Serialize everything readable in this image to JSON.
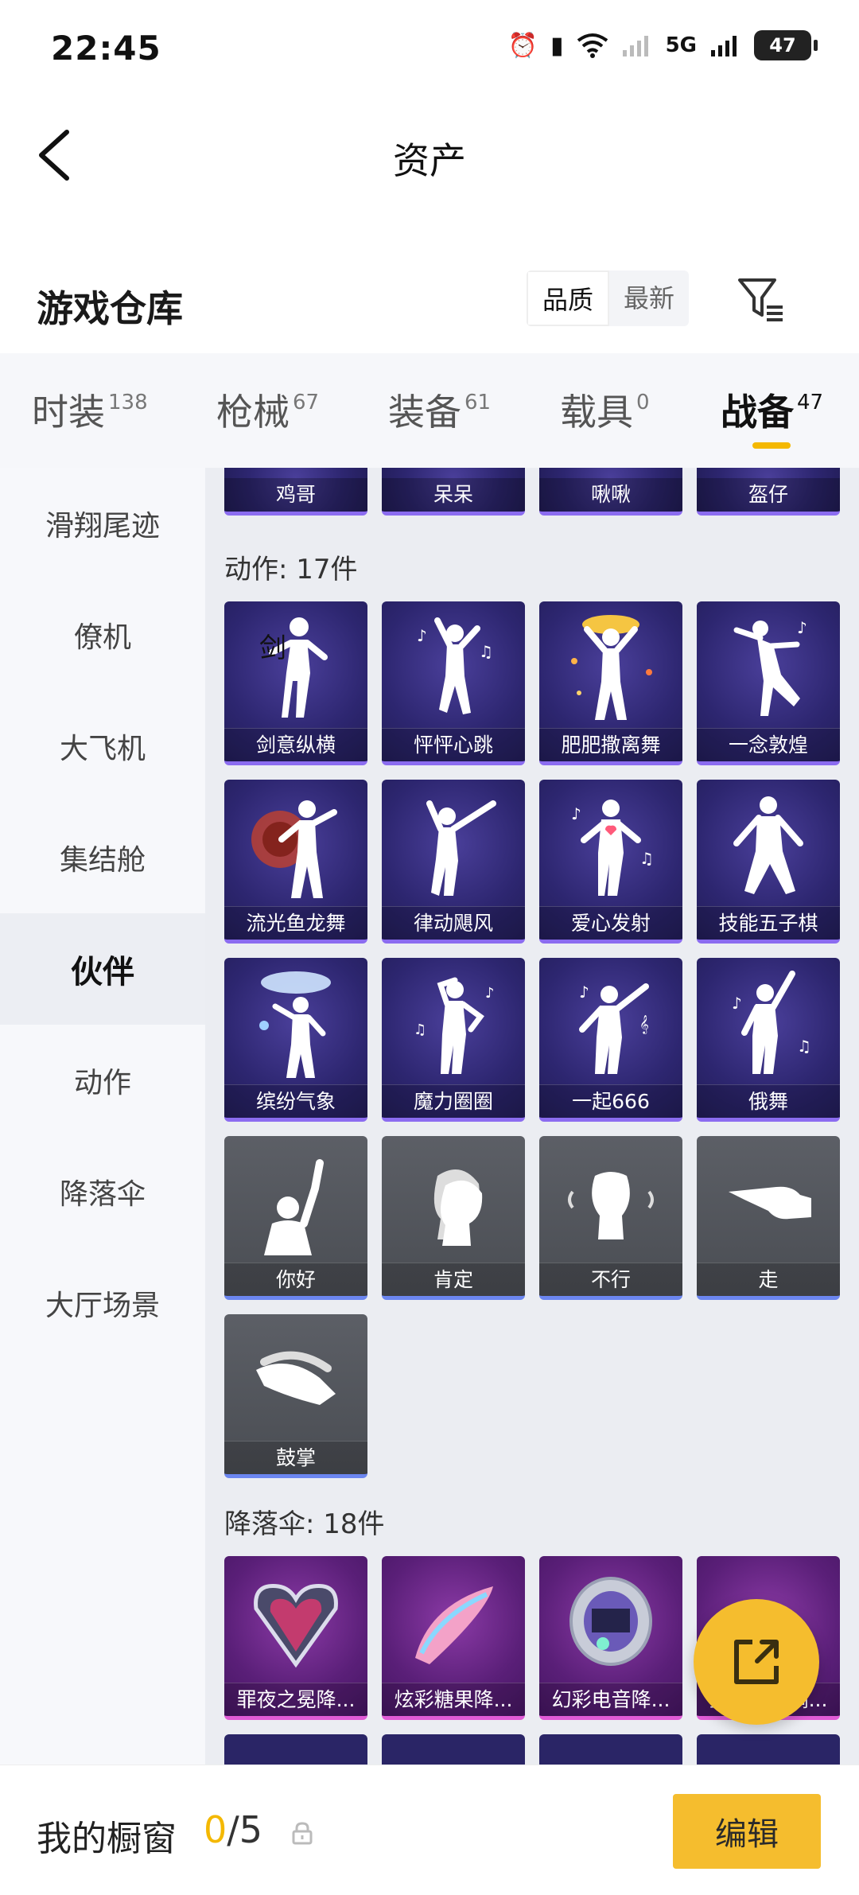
{
  "status_bar": {
    "time": "22:45",
    "battery": "47",
    "network": "5G"
  },
  "header": {
    "title": "资产"
  },
  "section": {
    "title": "游戏仓库"
  },
  "sort": {
    "options": [
      "品质",
      "最新"
    ],
    "active": "品质"
  },
  "tabs": [
    {
      "label": "时装",
      "count": "138"
    },
    {
      "label": "枪械",
      "count": "67"
    },
    {
      "label": "装备",
      "count": "61"
    },
    {
      "label": "载具",
      "count": "0"
    },
    {
      "label": "战备",
      "count": "47",
      "active": true
    }
  ],
  "sidebar": {
    "items": [
      "滑翔尾迹",
      "僚机",
      "大飞机",
      "集结舱",
      "伙伴",
      "动作",
      "降落伞",
      "大厅场景"
    ],
    "active": "伙伴"
  },
  "partners_row": [
    "鸡哥",
    "呆呆",
    "啾啾",
    "盔仔"
  ],
  "actions": {
    "title": "动作: 17件",
    "items": [
      "剑意纵横",
      "怦怦心跳",
      "肥肥撒离舞",
      "一念敦煌",
      "流光鱼龙舞",
      "律动飓风",
      "爱心发射",
      "技能五子棋",
      "缤纷气象",
      "魔力圈圈",
      "一起666",
      "俄舞",
      "你好",
      "肯定",
      "不行",
      "走",
      "鼓掌"
    ]
  },
  "parachutes": {
    "title": "降落伞: 18件",
    "items": [
      "罪夜之冕降...",
      "炫彩糖果降...",
      "幻彩电音降...",
      "星穹泳驭调..."
    ]
  },
  "bottom": {
    "label": "我的橱窗",
    "current": "0",
    "total": "/5",
    "edit_label": "编辑"
  },
  "colors": {
    "accent": "#f5bd2e",
    "purple_card": "#2d2670",
    "gray_card": "#4a4d53",
    "pink_card": "#5a1f78"
  }
}
